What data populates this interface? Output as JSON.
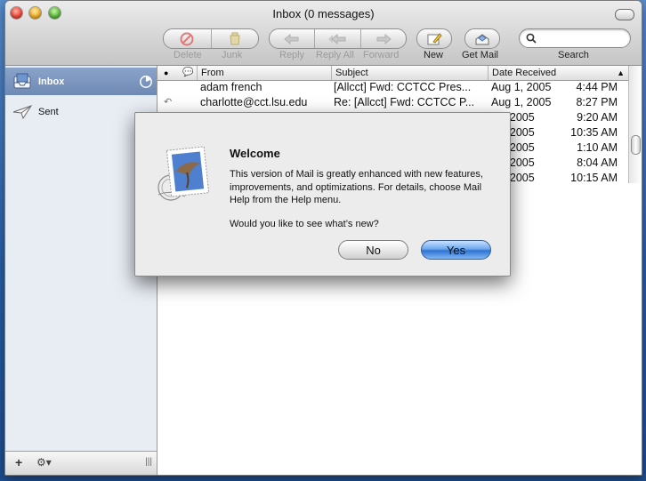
{
  "window": {
    "title": "Inbox (0 messages)"
  },
  "toolbar": {
    "delete_label": "Delete",
    "junk_label": "Junk",
    "reply_label": "Reply",
    "reply_all_label": "Reply All",
    "forward_label": "Forward",
    "new_label": "New",
    "get_mail_label": "Get Mail",
    "search_label": "Search",
    "search_value": ""
  },
  "sidebar": {
    "items": [
      {
        "label": "Inbox",
        "selected": true
      },
      {
        "label": "Sent",
        "selected": false
      }
    ]
  },
  "message_list": {
    "columns": {
      "from": "From",
      "subject": "Subject",
      "date": "Date Received"
    },
    "rows": [
      {
        "from": "adam french",
        "subject": "[Allcct] Fwd: CCTCC Pres...",
        "date": "Aug 1, 2005",
        "time": "4:44 PM",
        "replied": false
      },
      {
        "from": "charlotte@cct.lsu.edu",
        "subject": "Re: [Allcct] Fwd: CCTCC P...",
        "date": "Aug 1, 2005",
        "time": "8:27 PM",
        "replied": true
      },
      {
        "from": "",
        "subject": "",
        "date": "2, 2005",
        "time": "9:20 AM",
        "replied": false
      },
      {
        "from": "",
        "subject": "",
        "date": "3, 2005",
        "time": "10:35 AM",
        "replied": false
      },
      {
        "from": "",
        "subject": "",
        "date": "4, 2005",
        "time": "1:10 AM",
        "replied": false
      },
      {
        "from": "",
        "subject": "",
        "date": "4, 2005",
        "time": "8:04 AM",
        "replied": false
      },
      {
        "from": "",
        "subject": "",
        "date": "4, 2005",
        "time": "10:15 AM",
        "replied": false
      }
    ]
  },
  "dialog": {
    "title": "Welcome",
    "message": "This version of Mail is greatly enhanced with new features, improvements, and optimizations. For details, choose Mail Help from the Help menu.",
    "question": "Would you like to see what’s new?",
    "no_label": "No",
    "yes_label": "Yes"
  },
  "colors": {
    "selection": "#6e89b4",
    "default_button": "#2f73d4",
    "close": "#ef4b3c",
    "minimize": "#f4b325",
    "zoom": "#5fbf3d"
  }
}
